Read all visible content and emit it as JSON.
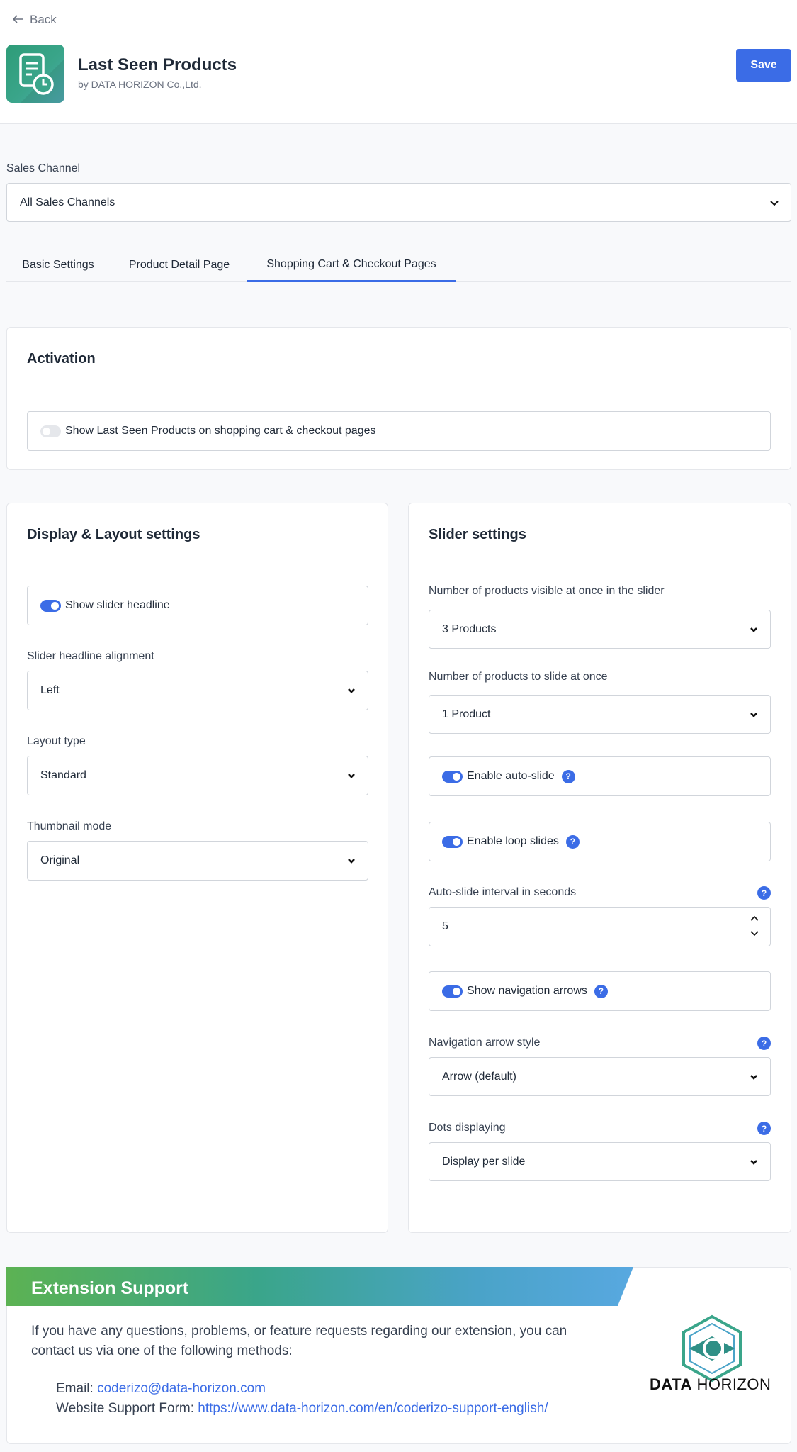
{
  "header": {
    "back_label": "Back",
    "app_title": "Last Seen Products",
    "app_vendor": "by DATA HORIZON Co.,Ltd.",
    "save_label": "Save"
  },
  "sales_channel": {
    "label": "Sales Channel",
    "value": "All Sales Channels"
  },
  "tabs": [
    {
      "label": "Basic Settings",
      "active": false
    },
    {
      "label": "Product Detail Page",
      "active": false
    },
    {
      "label": "Shopping Cart & Checkout Pages",
      "active": true
    }
  ],
  "activation": {
    "title": "Activation",
    "toggle_label": "Show Last Seen Products on shopping cart & checkout pages",
    "toggle_on": false
  },
  "display_layout": {
    "title": "Display & Layout settings",
    "show_headline_label": "Show slider headline",
    "show_headline_on": true,
    "alignment_label": "Slider headline alignment",
    "alignment_value": "Left",
    "layout_label": "Layout type",
    "layout_value": "Standard",
    "thumbnail_label": "Thumbnail mode",
    "thumbnail_value": "Original"
  },
  "slider": {
    "title": "Slider settings",
    "visible_label": "Number of products visible at once in the slider",
    "visible_value": "3 Products",
    "slide_label": "Number of products to slide at once",
    "slide_value": "1 Product",
    "auto_slide_label": "Enable auto-slide",
    "auto_slide_on": true,
    "loop_label": "Enable loop slides",
    "loop_on": true,
    "interval_label": "Auto-slide interval in seconds",
    "interval_value": "5",
    "nav_arrows_label": "Show navigation arrows",
    "nav_arrows_on": true,
    "arrow_style_label": "Navigation arrow style",
    "arrow_style_value": "Arrow (default)",
    "dots_label": "Dots displaying",
    "dots_value": "Display per slide",
    "help_glyph": "?"
  },
  "support": {
    "title": "Extension Support",
    "intro": "If you have any questions, problems, or feature requests regarding our extension, you can contact us via one of the following methods:",
    "email_prefix": "Email:",
    "email": "coderizo@data-horizon.com",
    "form_prefix": "Website Support Form:",
    "form_url": "https://www.data-horizon.com/en/coderizo-support-english/",
    "logo_word_bold": "DATA",
    "logo_word_rest": "HORIZON"
  },
  "colors": {
    "accent": "#3b6ce6",
    "toggle_off": "#e5e7eb"
  },
  "icons": {
    "back": "arrow-left-icon",
    "app": "document-clock-icon",
    "dropdown": "chevron-down-icon",
    "help": "question-icon",
    "stepper": "stepper-icon"
  }
}
